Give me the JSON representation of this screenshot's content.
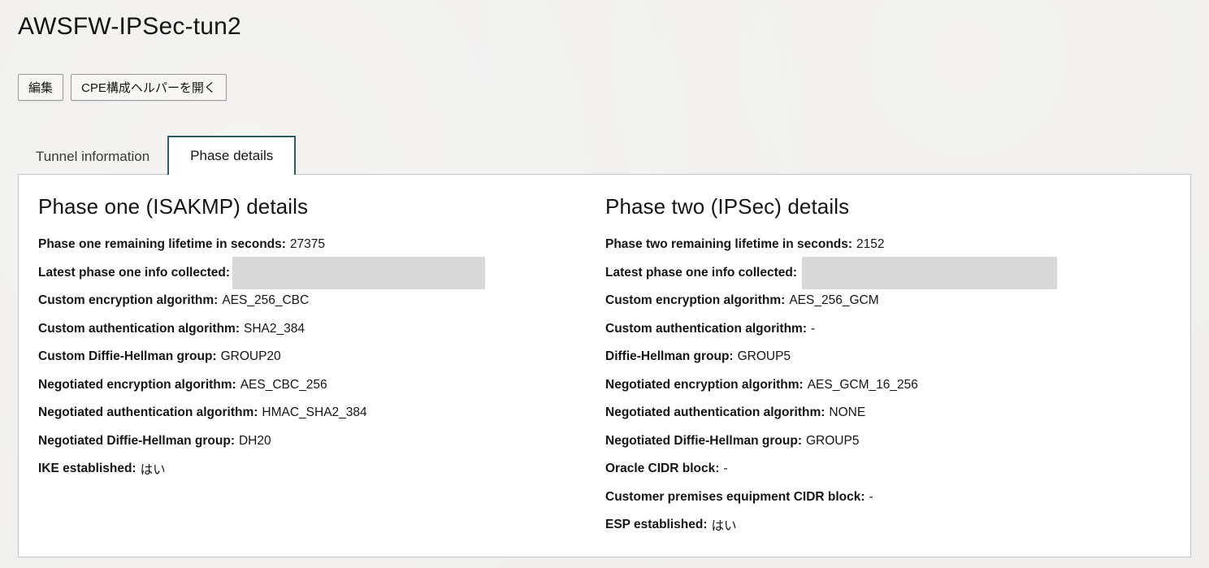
{
  "header": {
    "title": "AWSFW-IPSec-tun2"
  },
  "actions": {
    "edit_label": "編集",
    "cpe_helper_label": "CPE構成ヘルパーを開く"
  },
  "tabs": [
    {
      "label": "Tunnel information",
      "active": false
    },
    {
      "label": "Phase details",
      "active": true
    }
  ],
  "phase_one": {
    "heading": "Phase one (ISAKMP) details",
    "rows": [
      {
        "label": "Phase one remaining lifetime in seconds:",
        "value": "27375"
      },
      {
        "label": "Latest phase one info collected:",
        "value": ""
      },
      {
        "label": "Custom encryption algorithm:",
        "value": "AES_256_CBC"
      },
      {
        "label": "Custom authentication algorithm:",
        "value": "SHA2_384"
      },
      {
        "label": "Custom Diffie-Hellman group:",
        "value": "GROUP20"
      },
      {
        "label": "Negotiated encryption algorithm:",
        "value": "AES_CBC_256"
      },
      {
        "label": "Negotiated authentication algorithm:",
        "value": "HMAC_SHA2_384"
      },
      {
        "label": "Negotiated Diffie-Hellman group:",
        "value": "DH20"
      },
      {
        "label": "IKE established:",
        "value": "はい"
      }
    ]
  },
  "phase_two": {
    "heading": "Phase two (IPSec) details",
    "rows": [
      {
        "label": "Phase two remaining lifetime in seconds:",
        "value": "2152"
      },
      {
        "label": "Latest phase one info collected:",
        "value": ""
      },
      {
        "label": "Custom encryption algorithm:",
        "value": "AES_256_GCM"
      },
      {
        "label": "Custom authentication algorithm:",
        "value": "-"
      },
      {
        "label": "Diffie-Hellman group:",
        "value": "GROUP5"
      },
      {
        "label": "Negotiated encryption algorithm:",
        "value": "AES_GCM_16_256"
      },
      {
        "label": "Negotiated authentication algorithm:",
        "value": "NONE"
      },
      {
        "label": "Negotiated Diffie-Hellman group:",
        "value": "GROUP5"
      },
      {
        "label": "Oracle CIDR block:",
        "value": "-"
      },
      {
        "label": "Customer premises equipment CIDR block:",
        "value": "-"
      },
      {
        "label": "ESP established:",
        "value": "はい"
      }
    ]
  },
  "colors": {
    "active_tab_border": "#2e5d63",
    "redaction": "#d8d8d8"
  }
}
